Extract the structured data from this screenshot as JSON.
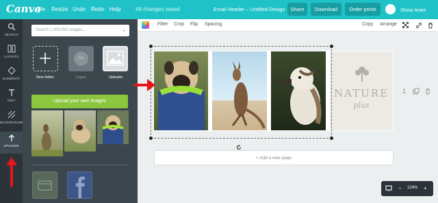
{
  "topbar": {
    "logo": "Canva",
    "menu": [
      "File",
      "Resize",
      "Undo",
      "Redo",
      "Help"
    ],
    "saved": "All changes saved",
    "doc_title": "Email Header – Untitled Design",
    "share": "Share",
    "download": "Download",
    "order_prints": "Order prints",
    "team": "Show team",
    "accent": "#1fc3c7"
  },
  "leftnav": [
    "SEARCH",
    "LAYOUTS",
    "ELEMENTS",
    "TEXT",
    "BACKGROUND",
    "UPLOADS"
  ],
  "panel": {
    "search_placeholder": "Search 1,000,000 images...",
    "new_folder": "New folder",
    "logos": "Logos",
    "logos_badge": "Co.",
    "uploads": "Uploads",
    "upload_button": "Upload your own images"
  },
  "toolbar": {
    "filter": "Filter",
    "crop": "Crop",
    "flip": "Flip",
    "spacing": "Spacing",
    "copy": "Copy",
    "arrange": "Arrange"
  },
  "canvas": {
    "nature_text": "NATURE",
    "plus_text": "plus",
    "page_number": "1",
    "add_page": "+ Add a new page"
  },
  "zoom": {
    "level": "124%",
    "minus": "−",
    "plus": "+"
  }
}
